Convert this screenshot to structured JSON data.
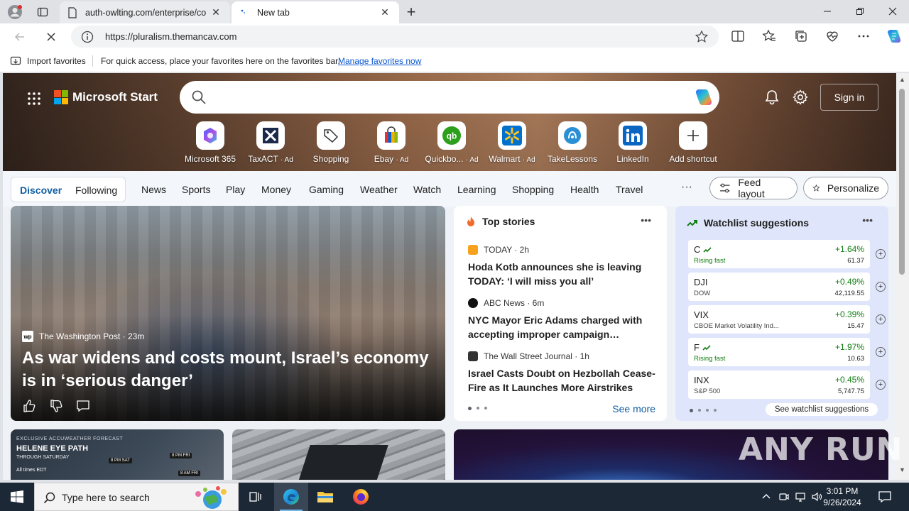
{
  "browser": {
    "tabs": [
      {
        "label": "auth-owlting.com/enterprise/co",
        "active": false
      },
      {
        "label": "New tab",
        "active": true
      }
    ],
    "address_url": "https://pluralism.themancav.com",
    "favorites_bar": {
      "import_label": "Import favorites",
      "message": "For quick access, place your favorites here on the favorites bar.",
      "link": "Manage favorites now"
    }
  },
  "start": {
    "brand": "Microsoft Start",
    "sign_in": "Sign in",
    "shortcuts": [
      {
        "label": "Microsoft 365",
        "ad": ""
      },
      {
        "label": "TaxACT",
        "ad": "· Ad"
      },
      {
        "label": "Shopping",
        "ad": ""
      },
      {
        "label": "Ebay",
        "ad": "· Ad"
      },
      {
        "label": "Quickbo...",
        "ad": "· Ad"
      },
      {
        "label": "Walmart",
        "ad": "· Ad"
      },
      {
        "label": "TakeLessons",
        "ad": ""
      },
      {
        "label": "LinkedIn",
        "ad": ""
      },
      {
        "label": "Add shortcut",
        "ad": ""
      }
    ],
    "nav": {
      "discover": "Discover",
      "following": "Following",
      "categories": [
        "News",
        "Sports",
        "Play",
        "Money",
        "Gaming",
        "Weather",
        "Watch",
        "Learning",
        "Shopping",
        "Health",
        "Travel"
      ],
      "more": "···",
      "feed_layout": "Feed layout",
      "personalize": "Personalize"
    },
    "main_story": {
      "source": "The Washington Post · 23m",
      "source_logo": "wp",
      "headline": "As war widens and costs mount, Israel’s economy is in ‘serious danger’"
    },
    "top_stories": {
      "title": "Top stories",
      "items": [
        {
          "source": "TODAY · 2h",
          "headline": "Hoda Kotb announces she is leaving TODAY: ‘I will miss you all’",
          "logo_color": "#f6a21d"
        },
        {
          "source": "ABC News · 6m",
          "headline": "NYC Mayor Eric Adams charged with accepting improper campaign…",
          "logo_color": "#000000"
        },
        {
          "source": "The Wall Street Journal · 1h",
          "headline": "Israel Casts Doubt on Hezbollah Cease-Fire as It Launches More Airstrikes",
          "logo_color": "#333333"
        }
      ],
      "see_more": "See more"
    },
    "watchlist": {
      "title": "Watchlist suggestions",
      "rows": [
        {
          "symbol": "C",
          "sub": "Rising fast",
          "rising": true,
          "change": "+1.64%",
          "value": "61.37"
        },
        {
          "symbol": "DJI",
          "sub": "DOW",
          "rising": false,
          "change": "+0.49%",
          "value": "42,119.55"
        },
        {
          "symbol": "VIX",
          "sub": "CBOE Market Volatility Ind...",
          "rising": false,
          "change": "+0.39%",
          "value": "15.47"
        },
        {
          "symbol": "F",
          "sub": "Rising fast",
          "rising": true,
          "change": "+1.97%",
          "value": "10.63"
        },
        {
          "symbol": "INX",
          "sub": "S&P 500",
          "rising": false,
          "change": "+0.45%",
          "value": "5,747.75"
        }
      ],
      "see_link": "See watchlist suggestions"
    },
    "lower_cards": {
      "weather_title_small": "EXCLUSIVE ACCUWEATHER FORECAST",
      "weather_title": "HELENE EYE PATH",
      "weather_sub": "THROUGH SATURDAY",
      "weather_note": "All times EDT",
      "weather_tags": [
        "8 PM FRI",
        "8 PM SAT",
        "8 AM FRI"
      ]
    }
  },
  "watermark": "ANY RUN",
  "taskbar": {
    "search_placeholder": "Type here to search",
    "time": "3:01 PM",
    "date": "9/26/2024"
  }
}
